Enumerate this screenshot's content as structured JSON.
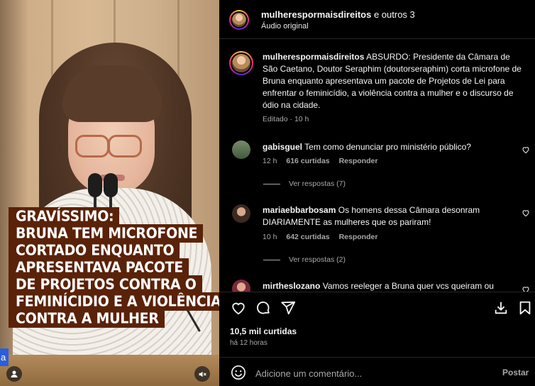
{
  "header": {
    "author": "mulherespormaisdireitos",
    "and_others": "e outros 3",
    "audio": "Áudio original"
  },
  "caption_post": {
    "username": "mulherespormaisdireitos",
    "text": "ABSURDO: Presidente da Câmara de São Caetano, Doutor Seraphim (doutorseraphim) corta microfone de Bruna enquanto apresentava um pacote de Projetos de Lei para enfrentar o feminicídio, a violência contra a mulher e o discurso de ódio na cidade.",
    "meta": "Editado · 10 h"
  },
  "comments": [
    {
      "username": "gabisguel",
      "text": "Tem como denunciar pro ministério público?",
      "time": "12 h",
      "likes": "616 curtidas",
      "reply": "Responder",
      "view_replies": "Ver respostas (7)"
    },
    {
      "username": "mariaebbarbosam",
      "text": "Os homens dessa Câmara desonram DIARIAMENTE as mulheres que os pariram!",
      "time": "10 h",
      "likes": "642 curtidas",
      "reply": "Responder",
      "view_replies": "Ver respostas (2)"
    },
    {
      "username": "mirtheslozano",
      "text": "Vamos reeleger a Bruna quer vcs queiram ou",
      "time": "",
      "likes": "",
      "reply": "",
      "view_replies": ""
    }
  ],
  "media": {
    "overlay_lines": [
      "GRAVÍSSIMO:",
      "BRUNA TEM MICROFONE",
      "CORTADO ENQUANTO",
      "APRESENTAVA PACOTE",
      "DE PROJETOS CONTRA O",
      "FEMINÍCIDIO E A VIOLÊNCIA",
      "CONTRA A MULHER"
    ],
    "tag_letter": "a",
    "caption_bg": "#5a2208"
  },
  "actions": {
    "icons": [
      "heart-icon",
      "comment-icon",
      "share-icon",
      "save-icon",
      "bookmark-icon"
    ]
  },
  "stats": {
    "likes": "10,5 mil curtidas",
    "time_ago": "há 12 horas"
  },
  "composer": {
    "placeholder": "Adicione um comentário...",
    "post_label": "Postar"
  }
}
